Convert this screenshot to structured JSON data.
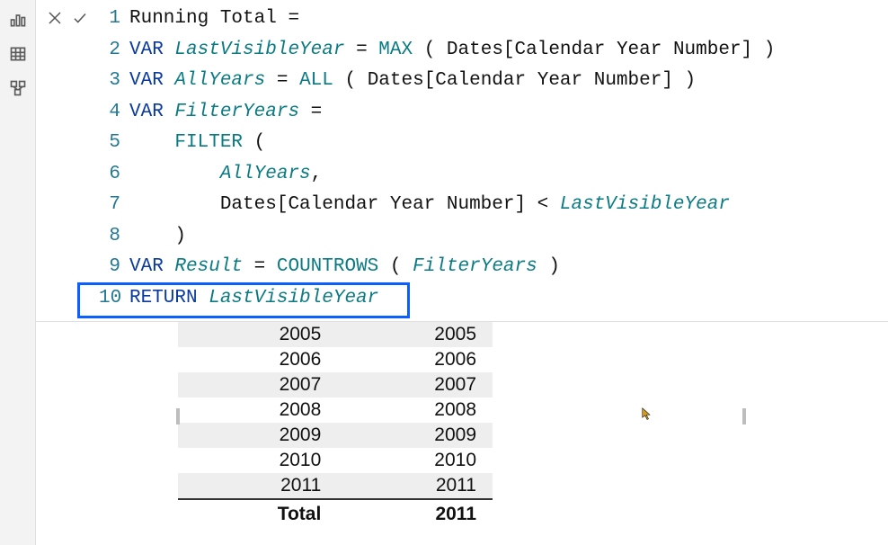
{
  "rail": {
    "icons": [
      "report-view-icon",
      "data-view-icon",
      "model-view-icon"
    ]
  },
  "formula_controls": {
    "cancel": "cancel-icon",
    "commit": "commit-icon"
  },
  "code": {
    "l1_measure": "Running Total ",
    "l1_eq": "=",
    "l2_var": "VAR ",
    "l2_name": "LastVisibleYear ",
    "l2_eq": "= ",
    "l2_fn": "MAX ",
    "l2_rest": "( Dates[Calendar Year Number] )",
    "l3_var": "VAR ",
    "l3_name": "AllYears ",
    "l3_eq": "= ",
    "l3_fn": "ALL ",
    "l3_rest": "( Dates[Calendar Year Number] )",
    "l4_var": "VAR ",
    "l4_name": "FilterYears ",
    "l4_eq": "=",
    "l5_indent": "    ",
    "l5_fn": "FILTER ",
    "l5_rest": "(",
    "l6_indent": "        ",
    "l6_name": "AllYears",
    "l6_rest": ",",
    "l7_indent": "        ",
    "l7_pre": "Dates[Calendar Year Number] < ",
    "l7_name": "LastVisibleYear",
    "l8_indent": "    ",
    "l8_rest": ")",
    "l9_var": "VAR ",
    "l9_name": "Result ",
    "l9_eq": "= ",
    "l9_fn": "COUNTROWS ",
    "l9_rest": "( ",
    "l9_arg": "FilterYears ",
    "l9_close": ")",
    "l10_ret": "RETURN ",
    "l10_name": "LastVisibleYear"
  },
  "line_numbers": {
    "l1": "1",
    "l2": "2",
    "l3": "3",
    "l4": "4",
    "l5": "5",
    "l6": "6",
    "l7": "7",
    "l8": "8",
    "l9": "9",
    "l10": "10"
  },
  "table": {
    "rows": [
      {
        "c1": "2005",
        "c2": "2005"
      },
      {
        "c1": "2006",
        "c2": "2006"
      },
      {
        "c1": "2007",
        "c2": "2007"
      },
      {
        "c1": "2008",
        "c2": "2008"
      },
      {
        "c1": "2009",
        "c2": "2009"
      },
      {
        "c1": "2010",
        "c2": "2010"
      },
      {
        "c1": "2011",
        "c2": "2011"
      }
    ],
    "total_label": "Total",
    "total_value": "2011"
  }
}
